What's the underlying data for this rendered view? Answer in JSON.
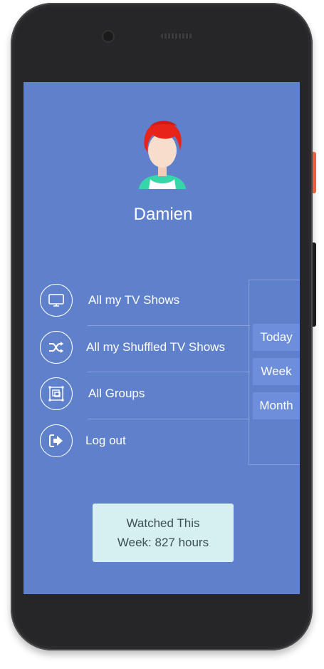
{
  "user": {
    "name": "Damien"
  },
  "menu": {
    "items": [
      {
        "label": "All my TV Shows",
        "icon": "tv-icon"
      },
      {
        "label": "All my Shuffled TV Shows",
        "icon": "shuffle-icon"
      },
      {
        "label": "All Groups",
        "icon": "groups-icon"
      },
      {
        "label": "Log out",
        "icon": "logout-icon"
      }
    ]
  },
  "filters": {
    "today": "Today",
    "week": "Week",
    "month": "Month"
  },
  "stats": {
    "line1": "Watched This",
    "line2": "Week: 827 hours"
  },
  "colors": {
    "screen_bg": "#5f81cc",
    "filter_bg": "#6d8fdb",
    "stats_bg": "#d5f0ef",
    "hair": "#e8231a",
    "shirt": "#35d6a8"
  }
}
